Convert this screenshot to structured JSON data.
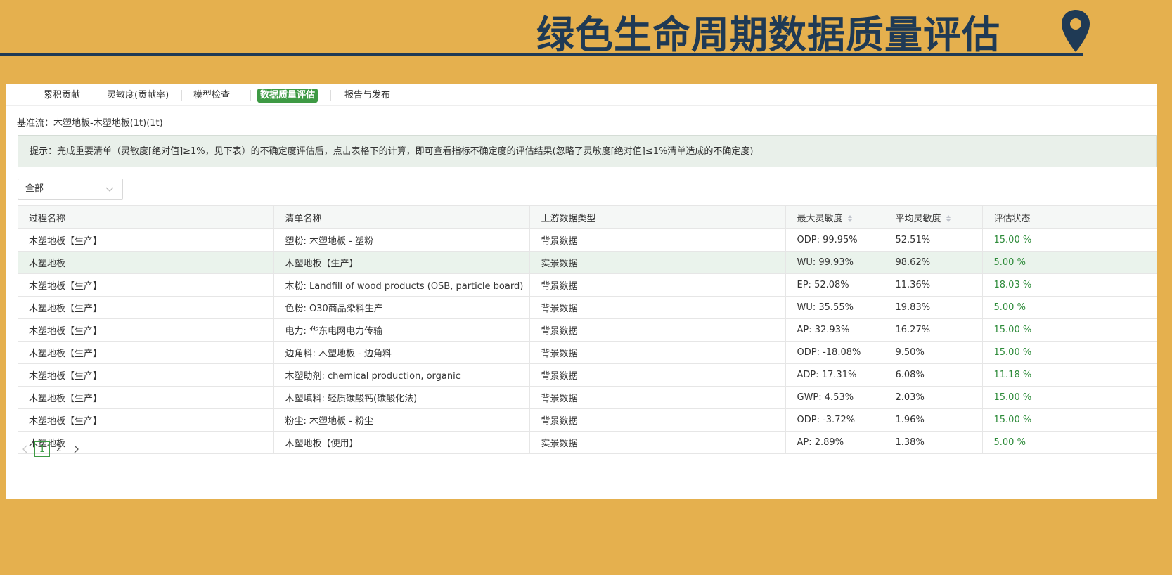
{
  "title": "绿色生命周期数据质量评估",
  "colors": {
    "background": "#E5B04E",
    "title": "#1F3A55",
    "accent": "#3E9A44",
    "status": "#2E8B3A"
  },
  "tabs": [
    {
      "label": "累积贡献",
      "active": false
    },
    {
      "label": "灵敏度(贡献率)",
      "active": false
    },
    {
      "label": "模型检查",
      "active": false
    },
    {
      "label": "数据质量评估",
      "active": true
    },
    {
      "label": "报告与发布",
      "active": false
    }
  ],
  "baseline": "基准流：木塑地板-木塑地板(1t)(1t)",
  "notice": "提示：完成重要清单（灵敏度[绝对值]≥1%，见下表）的不确定度评估后，点击表格下的计算，即可查看指标不确定度的评估结果(忽略了灵敏度[绝对值]≤1%清单造成的不确定度)",
  "filter": {
    "value": "全部",
    "icon": "chevron-down-icon"
  },
  "table": {
    "headers": [
      "过程名称",
      "清单名称",
      "上游数据类型",
      "最大灵敏度",
      "平均灵敏度",
      "评估状态"
    ],
    "rows": [
      [
        "木塑地板【生产】",
        "塑粉: 木塑地板 - 塑粉",
        "背景数据",
        "ODP: 99.95%",
        "52.51%",
        "15.00 %"
      ],
      [
        "木塑地板",
        "木塑地板【生产】",
        "实景数据",
        "WU: 99.93%",
        "98.62%",
        "5.00 %"
      ],
      [
        "木塑地板【生产】",
        "木粉: Landfill of wood products (OSB, particle board)",
        "背景数据",
        "EP: 52.08%",
        "11.36%",
        "18.03 %"
      ],
      [
        "木塑地板【生产】",
        "色粉: O30商品染料生产",
        "背景数据",
        "WU: 35.55%",
        "19.83%",
        "5.00 %"
      ],
      [
        "木塑地板【生产】",
        "电力: 华东电网电力传输",
        "背景数据",
        "AP: 32.93%",
        "16.27%",
        "15.00 %"
      ],
      [
        "木塑地板【生产】",
        "边角料: 木塑地板 - 边角料",
        "背景数据",
        "ODP: -18.08%",
        "9.50%",
        "15.00 %"
      ],
      [
        "木塑地板【生产】",
        "木塑助剂: chemical production, organic",
        "背景数据",
        "ADP: 17.31%",
        "6.08%",
        "11.18 %"
      ],
      [
        "木塑地板【生产】",
        "木塑填料: 轻质碳酸钙(碳酸化法)",
        "背景数据",
        "GWP: 4.53%",
        "2.03%",
        "15.00 %"
      ],
      [
        "木塑地板【生产】",
        "粉尘: 木塑地板 - 粉尘",
        "背景数据",
        "ODP: -3.72%",
        "1.96%",
        "15.00 %"
      ],
      [
        "木塑地板",
        "木塑地板【使用】",
        "实景数据",
        "AP: 2.89%",
        "1.38%",
        "5.00 %"
      ]
    ]
  },
  "pagination": {
    "pages": [
      "1",
      "2"
    ],
    "current": "1"
  }
}
